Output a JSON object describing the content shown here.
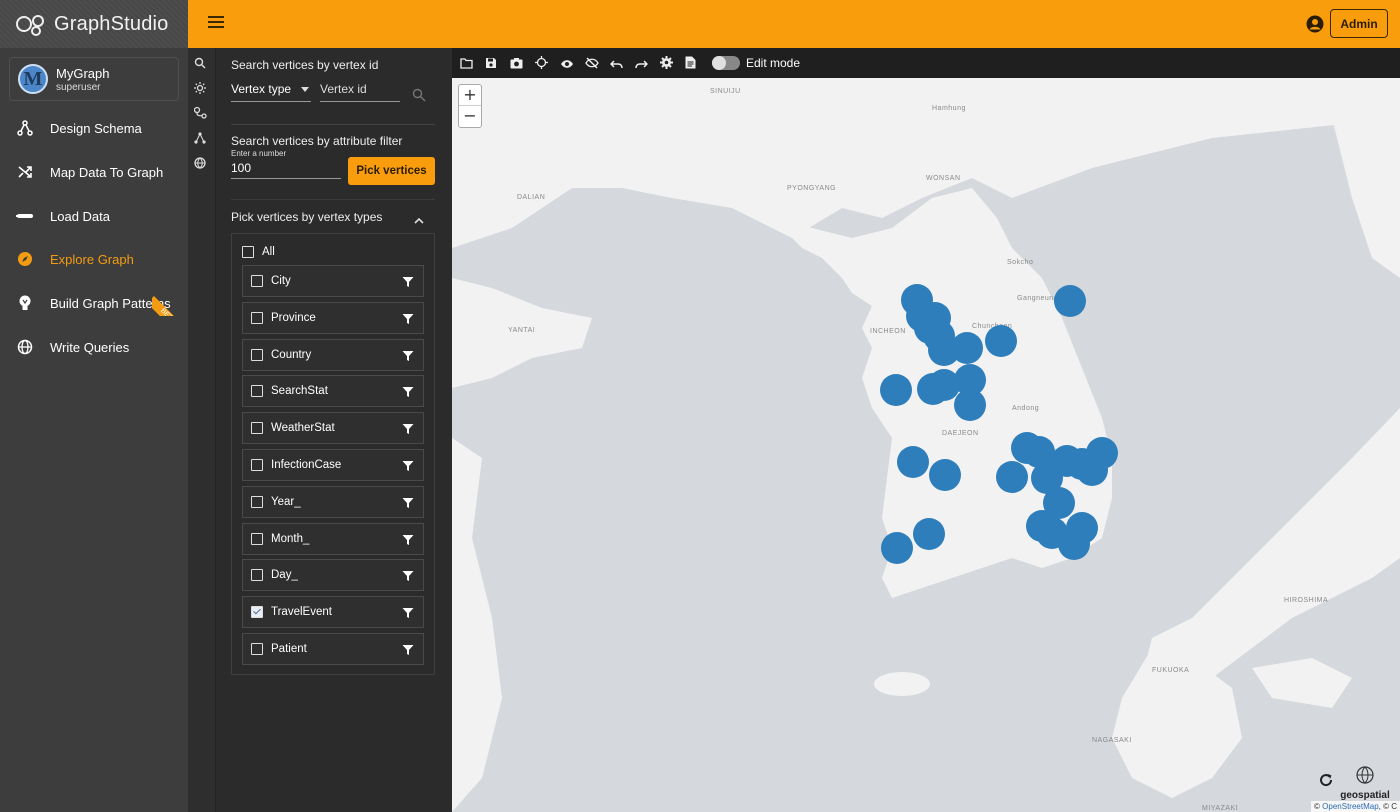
{
  "app": {
    "name": "GraphStudio"
  },
  "graph": {
    "initial": "M",
    "name": "MyGraph",
    "user": "superuser"
  },
  "nav": {
    "items": [
      {
        "label": "Design Schema",
        "icon": "schema-icon"
      },
      {
        "label": "Map Data To Graph",
        "icon": "shuffle-icon"
      },
      {
        "label": "Load Data",
        "icon": "load-icon"
      },
      {
        "label": "Explore Graph",
        "icon": "compass-icon",
        "active": true
      },
      {
        "label": "Build Graph Patterns",
        "icon": "bulb-icon",
        "badge": "BETA"
      },
      {
        "label": "Write Queries",
        "icon": "globe-code-icon"
      }
    ]
  },
  "topbar": {
    "admin_label": "Admin"
  },
  "search": {
    "title": "Search vertices by vertex id",
    "vertex_type_placeholder": "Vertex type",
    "vertex_id_placeholder": "Vertex id",
    "attr_title": "Search vertices by attribute filter",
    "number_hint": "Enter a number",
    "number_value": "100",
    "pick_button": "Pick vertices"
  },
  "vertex_types": {
    "title": "Pick vertices by vertex types",
    "all_label": "All",
    "items": [
      {
        "label": "City",
        "checked": false
      },
      {
        "label": "Province",
        "checked": false
      },
      {
        "label": "Country",
        "checked": false
      },
      {
        "label": "SearchStat",
        "checked": false
      },
      {
        "label": "WeatherStat",
        "checked": false
      },
      {
        "label": "InfectionCase",
        "checked": false
      },
      {
        "label": "Year_",
        "checked": false
      },
      {
        "label": "Month_",
        "checked": false
      },
      {
        "label": "Day_",
        "checked": false
      },
      {
        "label": "TravelEvent",
        "checked": true
      },
      {
        "label": "Patient",
        "checked": false
      }
    ]
  },
  "toolbar": {
    "edit_mode_label": "Edit mode"
  },
  "map": {
    "zoom_in": "+",
    "zoom_out": "−",
    "attribution_prefix": "©",
    "attribution_link": "OpenStreetMap",
    "attribution_suffix": ", © C",
    "logo_label": "geospatial",
    "marker_color": "#2f7ebc",
    "place_labels": [
      "SINUIJU",
      "PYONGYANG",
      "WONSAN",
      "DALIAN",
      "YANTAI",
      "INCHEON",
      "DAEJEON",
      "HIROSHIMA",
      "FUKUOKA",
      "NAGASAKI",
      "MIYAZAKI",
      "Hamhung",
      "Gangneung",
      "Andong",
      "Sokcho",
      "Chuncheon"
    ]
  },
  "colors": {
    "accent": "#f99d0d",
    "nav_bg": "#3d3d3d",
    "panel_bg": "#2b2b2b"
  }
}
